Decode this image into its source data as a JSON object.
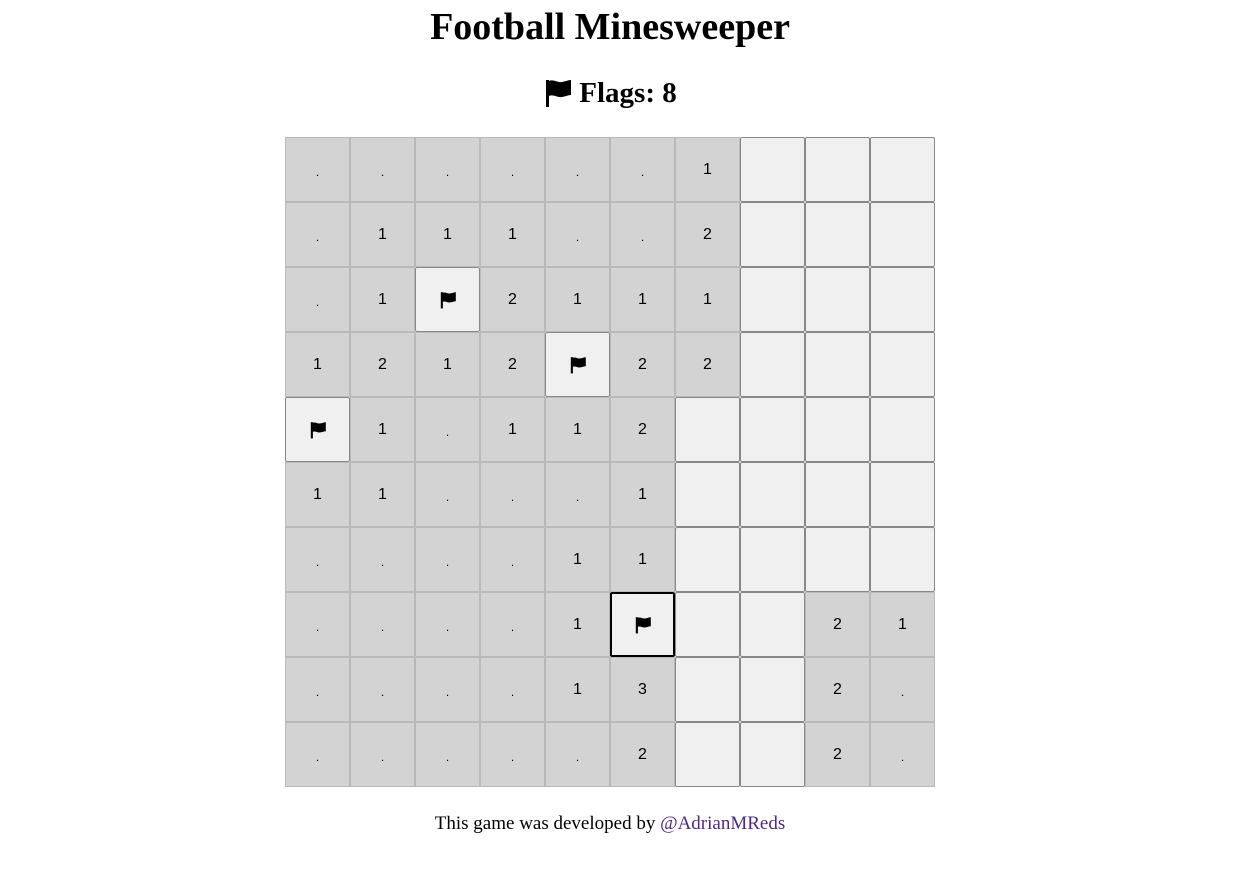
{
  "title": "Football Minesweeper",
  "flags": {
    "icon": "flag-icon",
    "label": "Flags: 8"
  },
  "board": {
    "rows": [
      [
        ".",
        ".",
        ".",
        ".",
        ".",
        ".",
        "1",
        "",
        "",
        ""
      ],
      [
        ".",
        "1",
        "1",
        "1",
        ".",
        ".",
        "2",
        "",
        "",
        ""
      ],
      [
        ".",
        "1",
        "F",
        "2",
        "1",
        "1",
        "1",
        "",
        "",
        ""
      ],
      [
        "1",
        "2",
        "1",
        "2",
        "F",
        "2",
        "2",
        "",
        "",
        ""
      ],
      [
        "F",
        "1",
        ".",
        "1",
        "1",
        "2",
        "",
        "",
        "",
        ""
      ],
      [
        "1",
        "1",
        ".",
        ".",
        ".",
        "1",
        "",
        "",
        "",
        ""
      ],
      [
        ".",
        ".",
        ".",
        ".",
        "1",
        "1",
        "",
        "",
        "",
        ""
      ],
      [
        ".",
        ".",
        ".",
        ".",
        "1",
        "F*",
        "",
        "",
        "2",
        "1"
      ],
      [
        ".",
        ".",
        ".",
        ".",
        "1",
        "3",
        "",
        "",
        "2",
        "."
      ],
      [
        ".",
        ".",
        ".",
        ".",
        ".",
        "2",
        "",
        "",
        "2",
        "."
      ]
    ],
    "legend": {
      "F": "flagged cell",
      "F*": "flagged and selected cell",
      "": "unrevealed cell",
      ".": "revealed empty cell"
    }
  },
  "footer": {
    "text": "This game was developed by",
    "link_text": "@AdrianMReds"
  },
  "colors": {
    "revealed": "#d3d3d3",
    "unrevealed": "#f0f0f0",
    "link": "#4b2a8a"
  }
}
